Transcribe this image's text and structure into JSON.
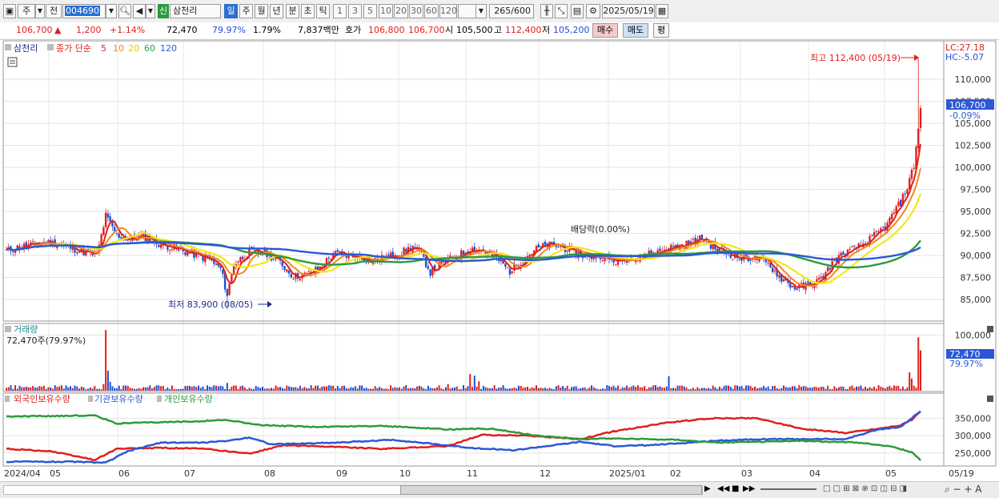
{
  "toolbar": {
    "market": "주",
    "prev": "전",
    "code": "004690",
    "badge": "신",
    "name": "삼천리",
    "periods": [
      "일",
      "주",
      "월",
      "년",
      "분",
      "초",
      "틱"
    ],
    "selected_period": "일",
    "intervals": [
      "1",
      "3",
      "5",
      "10",
      "20",
      "30",
      "60",
      "120"
    ],
    "count": "265",
    "count_total": "/600",
    "date": "2025/05/19"
  },
  "quote": {
    "price": "106,700",
    "change": "1,200",
    "change_pct": "+1.14%",
    "volume": "72,470",
    "vol_ratio": "79.97%",
    "turnover_rate": "1.79%",
    "amount": "7,837백만",
    "bid_label": "호가",
    "bid": "106,800",
    "ask": "106,700",
    "open_label": "시",
    "open": "105,500",
    "high_label": "고",
    "high": "112,400",
    "low_label": "저",
    "low": "105,200",
    "buy_button": "매수",
    "sell_button": "매도",
    "eval_button": "평"
  },
  "colors": {
    "up": "#e0201b",
    "down": "#1f4fd8",
    "ma5": "#e0201b",
    "ma10": "#f08a1c",
    "ma20": "#f5e61a",
    "ma60": "#2e9a3e",
    "ma120": "#2b58d6",
    "foreign": "#e0201b",
    "institution": "#2b58d6",
    "individual": "#2e9a3e"
  },
  "chart_data": [
    {
      "type": "candlestick",
      "legend": [
        "삼천리",
        "종가 단순",
        "5",
        "10",
        "20",
        "60",
        "120"
      ],
      "ylim": [
        83000,
        114000
      ],
      "yticks": [
        "85,000",
        "87,500",
        "90,000",
        "92,500",
        "95,000",
        "97,500",
        "100,000",
        "102,500",
        "105,000",
        "107,500",
        "110,000"
      ],
      "y_axis_markers": {
        "price": "106,700",
        "change": "-0.09%",
        "lc": "LC:27.18",
        "hc": "HC:-5.07"
      },
      "annotations": {
        "high": "최고 112,400 (05/19)",
        "low": "최저 83,900 (08/05)",
        "dividend": "배당락(0.00%)"
      },
      "x_labels": [
        "2024/04",
        "05",
        "06",
        "07",
        "08",
        "09",
        "10",
        "11",
        "12",
        "2025/01",
        "02",
        "03",
        "04",
        "05",
        "05/19"
      ],
      "close_approx": [
        [
          0,
          90500
        ],
        [
          6,
          91000
        ],
        [
          12,
          91200
        ],
        [
          18,
          91500
        ],
        [
          24,
          91300
        ],
        [
          30,
          90800
        ],
        [
          36,
          90300
        ],
        [
          41,
          90000
        ],
        [
          45,
          94500
        ],
        [
          50,
          92300
        ],
        [
          56,
          91800
        ],
        [
          62,
          92200
        ],
        [
          68,
          91400
        ],
        [
          74,
          91000
        ],
        [
          80,
          90500
        ],
        [
          86,
          90000
        ],
        [
          92,
          89500
        ],
        [
          97,
          88500
        ],
        [
          100,
          85500
        ],
        [
          103,
          89000
        ],
        [
          110,
          90400
        ],
        [
          118,
          90200
        ],
        [
          124,
          89200
        ],
        [
          130,
          87600
        ],
        [
          136,
          87800
        ],
        [
          142,
          88600
        ],
        [
          148,
          90200
        ],
        [
          154,
          90000
        ],
        [
          160,
          89800
        ],
        [
          166,
          89400
        ],
        [
          172,
          89800
        ],
        [
          178,
          90200
        ],
        [
          184,
          91000
        ],
        [
          188,
          90100
        ],
        [
          192,
          88100
        ],
        [
          198,
          89200
        ],
        [
          204,
          89900
        ],
        [
          210,
          90800
        ],
        [
          216,
          90500
        ],
        [
          222,
          89700
        ],
        [
          228,
          88200
        ],
        [
          233,
          89300
        ],
        [
          239,
          90600
        ],
        [
          245,
          91200
        ],
        [
          251,
          91000
        ],
        [
          257,
          90400
        ],
        [
          263,
          89800
        ],
        [
          269,
          90000
        ],
        [
          275,
          89300
        ],
        [
          281,
          89600
        ],
        [
          287,
          90000
        ],
        [
          293,
          90200
        ],
        [
          299,
          90800
        ],
        [
          305,
          91100
        ],
        [
          311,
          91500
        ],
        [
          315,
          92000
        ],
        [
          321,
          90800
        ],
        [
          327,
          90200
        ],
        [
          333,
          89600
        ],
        [
          339,
          89800
        ],
        [
          345,
          89000
        ],
        [
          351,
          87400
        ],
        [
          357,
          86300
        ],
        [
          363,
          86600
        ],
        [
          369,
          87300
        ],
        [
          375,
          89500
        ],
        [
          381,
          90400
        ],
        [
          387,
          91100
        ],
        [
          393,
          92200
        ],
        [
          399,
          93500
        ],
        [
          402,
          95000
        ],
        [
          405,
          96000
        ],
        [
          408,
          97800
        ],
        [
          411,
          100200
        ],
        [
          414,
          106700
        ]
      ],
      "high": 112400,
      "low": 83900
    },
    {
      "type": "bar",
      "title": "거래량",
      "current": "72,470주(79.97%)",
      "ylim": [
        0,
        115000
      ],
      "yticks": [
        "100,000"
      ],
      "y_axis_markers": {
        "value": "72,470",
        "pct": "79.97%"
      },
      "values_approx": [
        [
          0,
          5000
        ],
        [
          20,
          6000
        ],
        [
          44,
          12000
        ],
        [
          45,
          109000
        ],
        [
          46,
          36000
        ],
        [
          47,
          16000
        ],
        [
          100,
          14000
        ],
        [
          200,
          12000
        ],
        [
          210,
          30000
        ],
        [
          212,
          27000
        ],
        [
          214,
          17000
        ],
        [
          300,
          26000
        ],
        [
          409,
          33000
        ],
        [
          410,
          22000
        ],
        [
          413,
          96000
        ],
        [
          414,
          72470
        ]
      ]
    },
    {
      "type": "line",
      "legend": [
        "외국인보유수량",
        "기관보유수량",
        "개인보유수량"
      ],
      "ylim": [
        215000,
        390000
      ],
      "yticks": [
        "250,000",
        "300,000",
        "350,000"
      ],
      "series": [
        {
          "name": "외국인보유수량",
          "values": [
            [
              0,
              262000
            ],
            [
              20,
              255000
            ],
            [
              40,
              230000
            ],
            [
              50,
              262000
            ],
            [
              70,
              265000
            ],
            [
              90,
              262000
            ],
            [
              110,
              248000
            ],
            [
              125,
              272000
            ],
            [
              140,
              270000
            ],
            [
              170,
              262000
            ],
            [
              200,
              270000
            ],
            [
              215,
              302000
            ],
            [
              235,
              300000
            ],
            [
              260,
              290000
            ],
            [
              275,
              312000
            ],
            [
              300,
              338000
            ],
            [
              320,
              350000
            ],
            [
              340,
              350000
            ],
            [
              360,
              320000
            ],
            [
              380,
              308000
            ],
            [
              395,
              320000
            ],
            [
              405,
              330000
            ],
            [
              410,
              345000
            ],
            [
              414,
              370000
            ]
          ]
        },
        {
          "name": "기관보유수량",
          "values": [
            [
              0,
              225000
            ],
            [
              30,
              225000
            ],
            [
              45,
              222000
            ],
            [
              55,
              255000
            ],
            [
              70,
              280000
            ],
            [
              90,
              280000
            ],
            [
              100,
              285000
            ],
            [
              110,
              295000
            ],
            [
              120,
              275000
            ],
            [
              150,
              280000
            ],
            [
              175,
              288000
            ],
            [
              190,
              278000
            ],
            [
              210,
              265000
            ],
            [
              230,
              258000
            ],
            [
              245,
              270000
            ],
            [
              260,
              282000
            ],
            [
              275,
              270000
            ],
            [
              290,
              272000
            ],
            [
              305,
              278000
            ],
            [
              320,
              285000
            ],
            [
              340,
              290000
            ],
            [
              380,
              290000
            ],
            [
              395,
              318000
            ],
            [
              405,
              325000
            ],
            [
              414,
              370000
            ]
          ]
        },
        {
          "name": "개인보유수량",
          "values": [
            [
              0,
              355000
            ],
            [
              40,
              358000
            ],
            [
              50,
              335000
            ],
            [
              80,
              340000
            ],
            [
              100,
              345000
            ],
            [
              115,
              330000
            ],
            [
              140,
              325000
            ],
            [
              170,
              328000
            ],
            [
              200,
              318000
            ],
            [
              220,
              320000
            ],
            [
              240,
              300000
            ],
            [
              260,
              290000
            ],
            [
              275,
              292000
            ],
            [
              290,
              290000
            ],
            [
              305,
              288000
            ],
            [
              320,
              280000
            ],
            [
              340,
              282000
            ],
            [
              360,
              285000
            ],
            [
              385,
              280000
            ],
            [
              400,
              270000
            ],
            [
              410,
              252000
            ],
            [
              414,
              230000
            ]
          ]
        }
      ]
    }
  ]
}
